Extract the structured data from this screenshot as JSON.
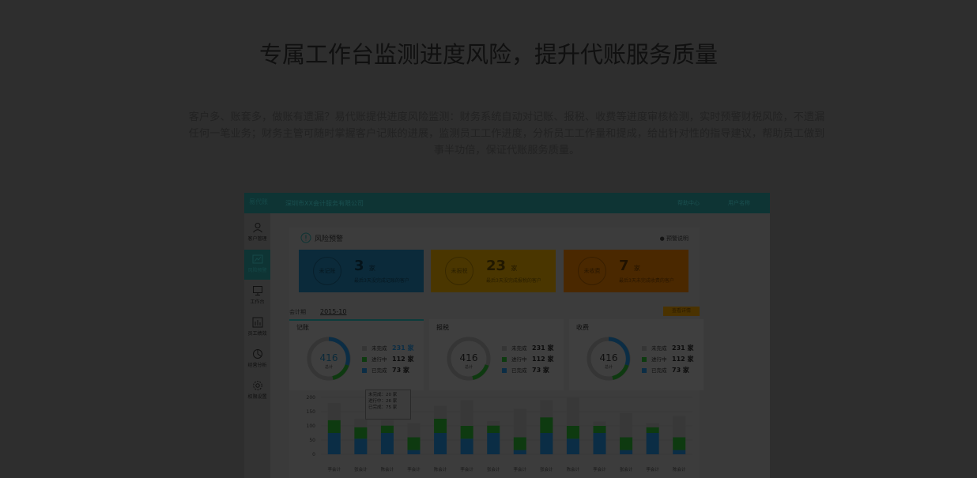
{
  "headline": "专属工作台监测进度风险，提升代账服务质量",
  "description": "客户多、账套多，做账有遗漏？易代账提供进度风险监测：财务系统自动对记账、报税、收费等进度审核检测，实时预警财税风险，不遗漏任何一笔业务；财务主管可随时掌握客户记账的进展，监测员工工作进度，分析员工工作量和提成，给出针对性的指导建议，帮助员工做到事半功倍，保证代账服务质量。",
  "app": {
    "logo_text": "易代账",
    "company": "深圳市XX会计服务有限公司",
    "topbar_right": [
      "帮助中心",
      "用户名称"
    ],
    "colors": {
      "teal": "#0e3434",
      "blue": "#0b2a3a",
      "orange": "#4a3200",
      "green": "#0e3a10",
      "bar_blue": "#0b2d45"
    },
    "sidebar": [
      {
        "label": "客户管理",
        "icon": "user-icon"
      },
      {
        "label": "风险预警",
        "icon": "chart-icon",
        "active": true
      },
      {
        "label": "工作台",
        "icon": "monitor-icon"
      },
      {
        "label": "员工绩效",
        "icon": "bars-icon"
      },
      {
        "label": "经营分析",
        "icon": "pie-icon"
      },
      {
        "label": "权限设置",
        "icon": "gear-icon"
      }
    ],
    "risk": {
      "title": "风险预警",
      "help": "预警说明",
      "cards": [
        {
          "ring": "未记账",
          "count": "3",
          "unit": "家",
          "sub": "最后3天没完成记账的客户"
        },
        {
          "ring": "未报税",
          "count": "23",
          "unit": "家",
          "sub": "最后3天没完成报税的客户"
        },
        {
          "ring": "未收费",
          "count": "7",
          "unit": "家",
          "sub": "最后3天未完成收费的客户"
        }
      ]
    },
    "period_label": "会计期",
    "period_value": "2015-10",
    "orange_button": "查看详情",
    "summaries": [
      {
        "title": "记账",
        "total": "416",
        "total_label": "总计",
        "items": [
          [
            "未完成",
            "231 家"
          ],
          [
            "进行中",
            "112 家"
          ],
          [
            "已完成",
            "73 家"
          ]
        ]
      },
      {
        "title": "报税",
        "total": "416",
        "total_label": "总计",
        "items": [
          [
            "未完成",
            "231 家"
          ],
          [
            "进行中",
            "112 家"
          ],
          [
            "已完成",
            "73 家"
          ]
        ]
      },
      {
        "title": "收费",
        "total": "416",
        "total_label": "总计",
        "items": [
          [
            "未完成",
            "231 家"
          ],
          [
            "进行中",
            "112 家"
          ],
          [
            "已完成",
            "73 家"
          ]
        ]
      }
    ],
    "tooltip": [
      "未完成：20 家",
      "进行中：26 家",
      "已完成：75 家"
    ]
  },
  "chart_data": {
    "type": "bar",
    "stacked": true,
    "y_ticks": [
      "200",
      "150",
      "100",
      "50",
      "0"
    ],
    "ylim": [
      0,
      200
    ],
    "categories": [
      "李会计",
      "张会计",
      "陈会计",
      "李会计",
      "陈会计",
      "李会计",
      "张会计",
      "李会计",
      "张会计",
      "陈会计",
      "李会计",
      "张会计",
      "李会计",
      "陈会计"
    ],
    "series": [
      {
        "name": "已完成",
        "values": [
          75,
          55,
          75,
          15,
          75,
          55,
          75,
          15,
          75,
          55,
          75,
          15,
          75,
          15
        ]
      },
      {
        "name": "进行中",
        "values": [
          45,
          40,
          26,
          45,
          50,
          45,
          26,
          45,
          55,
          45,
          25,
          45,
          20,
          45
        ]
      },
      {
        "name": "未完成",
        "values": [
          60,
          30,
          20,
          50,
          45,
          90,
          15,
          100,
          60,
          100,
          15,
          85,
          15,
          75
        ]
      }
    ]
  }
}
